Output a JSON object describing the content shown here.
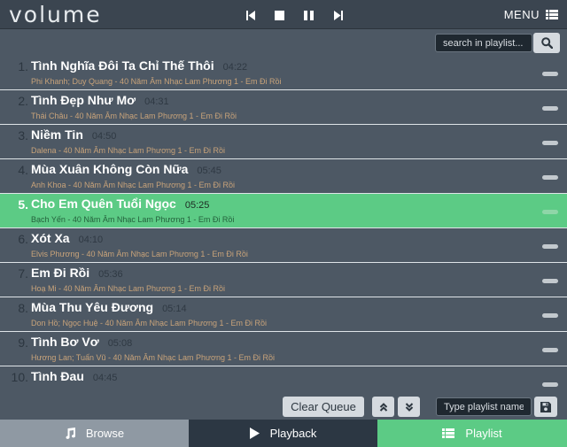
{
  "app": {
    "logo": "volume"
  },
  "transport": [
    "prev-icon",
    "stop-icon",
    "pause-icon",
    "next-icon"
  ],
  "menu": {
    "label": "MENU",
    "icon": "list-icon"
  },
  "search": {
    "placeholder": "search in playlist...",
    "icon": "search-icon"
  },
  "tracks": [
    {
      "num": "1.",
      "title": "Tình Nghĩa Đôi Ta Chỉ Thế Thôi",
      "duration": "04:22",
      "meta": "Phi Khanh; Duy Quang - 40 Năm Âm Nhạc Lam Phương 1 - Em Đi Rồi",
      "active": false
    },
    {
      "num": "2.",
      "title": "Tình Đẹp Như Mơ",
      "duration": "04:31",
      "meta": "Thái Châu - 40 Năm Âm Nhạc Lam Phương 1 - Em Đi Rồi",
      "active": false
    },
    {
      "num": "3.",
      "title": "Niềm Tin",
      "duration": "04:50",
      "meta": "Dalena - 40 Năm Âm Nhạc Lam Phương 1 - Em Đi Rồi",
      "active": false
    },
    {
      "num": "4.",
      "title": "Mùa Xuân Không Còn Nữa",
      "duration": "05:45",
      "meta": "Anh Khoa - 40 Năm Âm Nhạc Lam Phương 1 - Em Đi Rồi",
      "active": false
    },
    {
      "num": "5.",
      "title": "Cho Em Quên Tuổi Ngọc",
      "duration": "05:25",
      "meta": "Bạch Yến - 40 Năm Âm Nhạc Lam Phương 1 - Em Đi Rồi",
      "active": true
    },
    {
      "num": "6.",
      "title": "Xót Xa",
      "duration": "04:10",
      "meta": "Elvis Phương - 40 Năm Âm Nhạc Lam Phương 1 - Em Đi Rồi",
      "active": false
    },
    {
      "num": "7.",
      "title": "Em Đi Rồi",
      "duration": "05:36",
      "meta": "Hoạ Mi - 40 Năm Âm Nhạc Lam Phương 1 - Em Đi Rồi",
      "active": false
    },
    {
      "num": "8.",
      "title": "Mùa Thu Yêu Đương",
      "duration": "05:14",
      "meta": "Don Hồ; Ngọc Huệ - 40 Năm Âm Nhạc Lam Phương 1 - Em Đi Rồi",
      "active": false
    },
    {
      "num": "9.",
      "title": "Tình Bơ Vơ",
      "duration": "05:08",
      "meta": "Hương Lan; Tuấn Vũ - 40 Năm Âm Nhạc Lam Phương 1 - Em Đi Rồi",
      "active": false
    },
    {
      "num": "10.",
      "title": "Tình Đau",
      "duration": "04:45",
      "meta": "",
      "active": false
    }
  ],
  "controls": {
    "clear_label": "Clear Queue",
    "up_icon": "chevron-double-up-icon",
    "down_icon": "chevron-double-down-icon",
    "playlist_name_placeholder": "Type playlist name",
    "save_icon": "save-icon"
  },
  "footer": {
    "browse": {
      "label": "Browse",
      "icon": "music-note-icon"
    },
    "playback": {
      "label": "Playback",
      "icon": "play-icon"
    },
    "playlist": {
      "label": "Playlist",
      "icon": "list-icon"
    }
  },
  "colors": {
    "background": "#4d5864",
    "topbar": "#3b4550",
    "active_track": "#5ccb85",
    "tab_browse": "#8f99a3",
    "tab_playback": "#2c3743",
    "tab_playlist": "#5ccb85"
  }
}
